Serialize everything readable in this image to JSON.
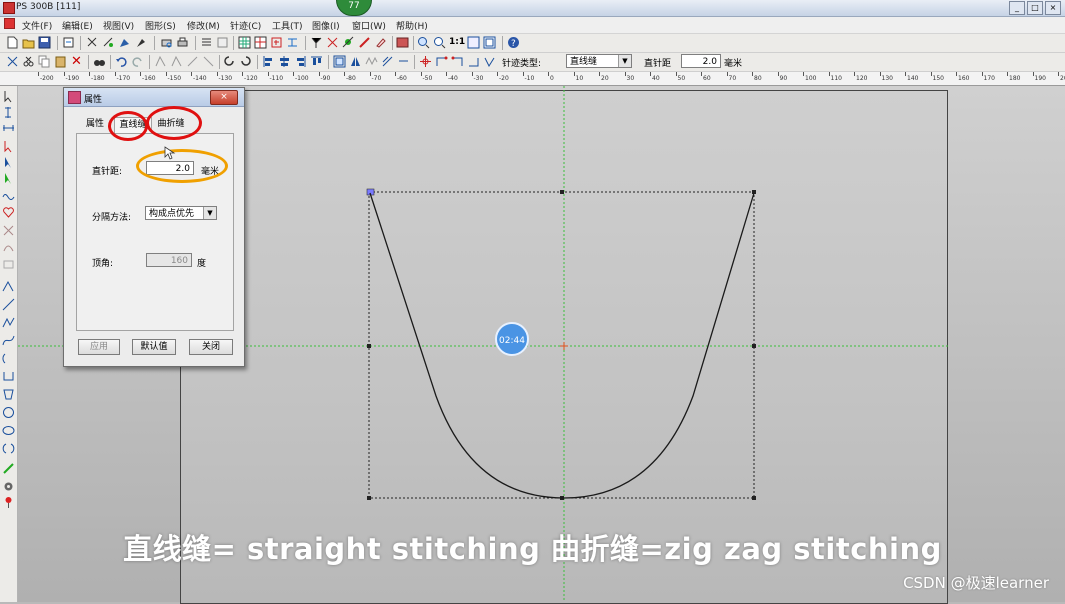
{
  "window": {
    "title": "PS 300B  [111]",
    "badge": "77",
    "minimize": "_",
    "maximize": "□",
    "close": "×"
  },
  "menu": [
    "文件(F)",
    "编辑(E)",
    "视图(V)",
    "图形(S)",
    "修改(M)",
    "针迹(C)",
    "工具(T)",
    "图像(I)",
    "窗口(W)",
    "帮助(H)"
  ],
  "toolbar2": {
    "stitch_type_label": "针迹类型:",
    "stitch_type_value": "直线缝",
    "straight_pitch_label": "直针距",
    "straight_pitch_value": "2.0",
    "unit": "毫米"
  },
  "ruler_labels": [
    "-200",
    "-190",
    "-180",
    "-170",
    "-160",
    "-150",
    "-140",
    "-130",
    "-120",
    "-110",
    "-100",
    "-90",
    "-80",
    "-70",
    "-60",
    "-50",
    "-40",
    "-30",
    "-20",
    "-10",
    "0",
    "10",
    "20",
    "30",
    "40",
    "50",
    "60",
    "70",
    "80",
    "90",
    "100",
    "110",
    "120",
    "130",
    "140",
    "150",
    "160",
    "170",
    "180",
    "190",
    "200"
  ],
  "dialog": {
    "title": "属性",
    "close": "×",
    "tabs": [
      "属性",
      "直线缝",
      "曲折缝"
    ],
    "pitch_label": "直针距:",
    "pitch_value": "2.0",
    "pitch_unit": "毫米",
    "split_label": "分隔方法:",
    "split_value": "构成点优先",
    "angle_label": "顶角:",
    "angle_value": "160",
    "angle_unit": "度",
    "buttons": {
      "apply": "应用",
      "default": "默认值",
      "close": "关闭"
    }
  },
  "timer": "02:44",
  "subtitle": "直线缝= straight stitching     曲折缝=zig zag stitching",
  "watermark": "CSDN @极速learner",
  "colors": {
    "annotation_red": "#e01010",
    "annotation_orange": "#f0a000",
    "guide_green": "#3cbe3c",
    "timer_blue": "#4a94e4"
  }
}
